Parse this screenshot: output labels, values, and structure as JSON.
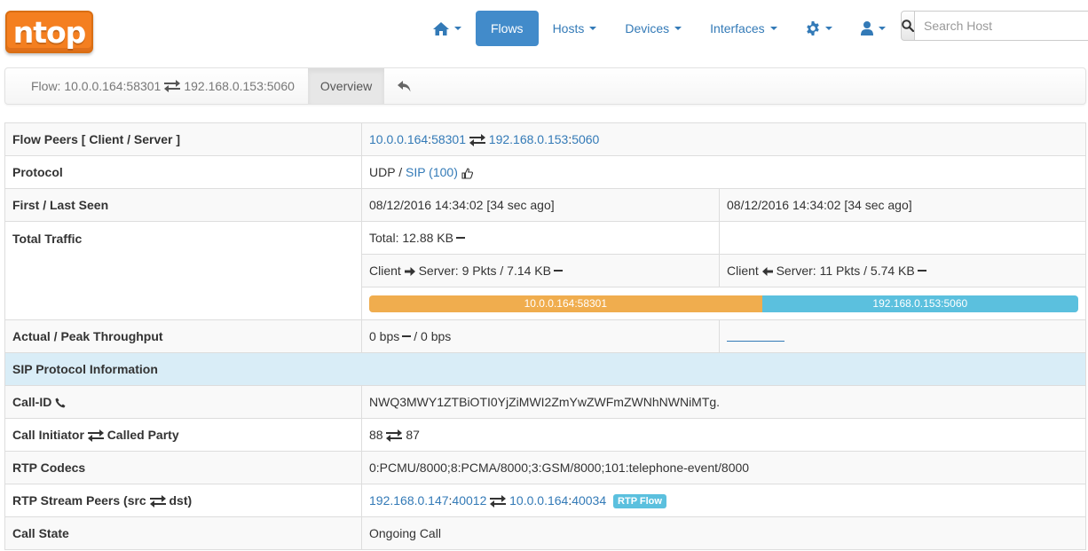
{
  "brand": {
    "logo_text": "ntop",
    "logo_color": "#f47f20"
  },
  "nav": {
    "home_icon": "home-icon",
    "flows": "Flows",
    "hosts": "Hosts",
    "devices": "Devices",
    "interfaces": "Interfaces",
    "settings_icon": "gear-icon",
    "user_icon": "user-icon",
    "active_color": "#428bca"
  },
  "search": {
    "placeholder": "Search Host",
    "icon": "search-icon"
  },
  "breadcrumb": {
    "prefix": "Flow: ",
    "client": "10.0.0.164:58301",
    "server": "192.168.0.153:5060",
    "tab": "Overview",
    "back_icon": "reply-icon"
  },
  "table": {
    "flow_peers": {
      "label": "Flow Peers [ Client / Server ]",
      "client_ip": "10.0.0.164",
      "client_port": "58301",
      "server_ip": "192.168.0.153",
      "server_port": "5060"
    },
    "protocol": {
      "label": "Protocol",
      "l4": "UDP / ",
      "l7": "SIP (100)"
    },
    "seen": {
      "label": "First / Last Seen",
      "first": "08/12/2016 14:34:02 [34 sec ago]",
      "last": "08/12/2016 14:34:02 [34 sec ago]"
    },
    "traffic": {
      "label": "Total Traffic",
      "total": "Total: 12.88 KB",
      "cli2srv_prefix": "Client ",
      "cli2srv": " Server: 9 Pkts / 7.14 KB",
      "srv2cli_prefix": "Client ",
      "srv2cli": " Server: 11 Pkts / 5.74 KB",
      "bar_client_label": "10.0.0.164:58301",
      "bar_server_label": "192.168.0.153:5060",
      "bar_client_fraction": 0.554
    },
    "throughput": {
      "label": "Actual / Peak Throughput",
      "actual": "0 bps",
      "peak": "/ 0 bps"
    },
    "sip_section": "SIP Protocol Information",
    "call_id": {
      "label": "Call-ID",
      "value": "NWQ3MWY1ZTBiOTI0YjZiMWI2ZmYwZWFmZWNhNWNiMTg."
    },
    "initiator": {
      "label_a": "Call Initiator",
      "label_b": "Called Party",
      "from": "88",
      "to": "87"
    },
    "codecs": {
      "label": "RTP Codecs",
      "value": "0:PCMU/8000;8:PCMA/8000;3:GSM/8000;101:telephone-event/8000"
    },
    "rtp_peers": {
      "label_a": "RTP Stream Peers (src",
      "label_b": "dst)",
      "src_ip": "192.168.0.147",
      "src_port": "40012",
      "dst_ip": "10.0.0.164",
      "dst_port": "40034",
      "badge": "RTP Flow"
    },
    "call_state": {
      "label": "Call State",
      "value": "Ongoing Call"
    }
  }
}
